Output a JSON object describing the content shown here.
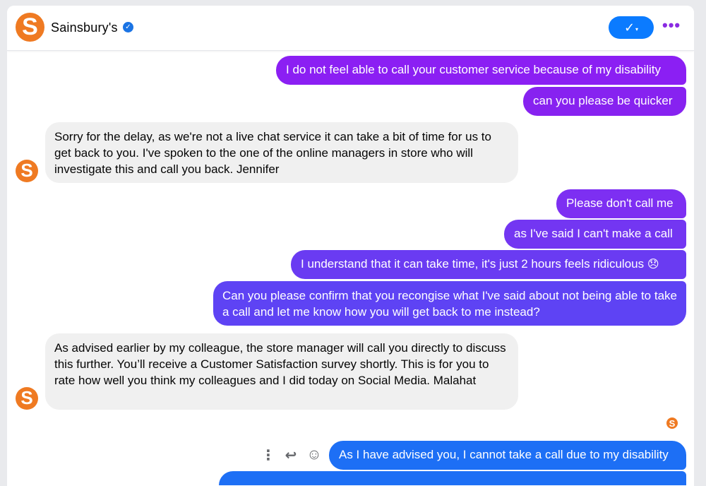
{
  "header": {
    "contact_name": "Sainsbury's",
    "logo_letter": "S",
    "verified_icon": "check",
    "done_button_glyph": "✓",
    "done_button_caret": "▾",
    "more_glyph": "•••"
  },
  "colors": {
    "brand_orange": "#ef7a22",
    "accent_blue": "#0b7bff",
    "accent_purple": "#8a2be2",
    "incoming_bg": "#f0f0f0"
  },
  "messages": [
    {
      "direction": "out",
      "text": "I do not feel able to call your customer service because of my disability"
    },
    {
      "direction": "out",
      "text": "can you please be quicker"
    },
    {
      "direction": "in",
      "text": "Sorry for the delay, as we're not a live chat service it can take a bit of time for us to get back to you. I've spoken to the one of the online managers in store who will investigate this and call you back. Jennifer"
    },
    {
      "direction": "out",
      "text": "Please don't call me"
    },
    {
      "direction": "out",
      "text": "as I've said I can't make a call"
    },
    {
      "direction": "out",
      "text": "I understand that it can take time, it's just 2 hours feels ridiculous",
      "emoji": "😞"
    },
    {
      "direction": "out",
      "text": "Can you please confirm that you recongise what I've said about not being able to take a call and let me know how you will get back to me instead?"
    },
    {
      "direction": "in",
      "text": "As advised earlier by my colleague, the store manager will call you directly to discuss this further. You’ll receive a Customer Satisfaction survey shortly. This is for you to rate how well you think my colleagues and I did today on Social Media. Malahat"
    },
    {
      "direction": "out",
      "text": "As I have advised you, I cannot take a call due to my disability"
    }
  ],
  "message_actions": {
    "more_glyph": "⋮",
    "reply_glyph": "↩",
    "react_glyph": "☺"
  }
}
